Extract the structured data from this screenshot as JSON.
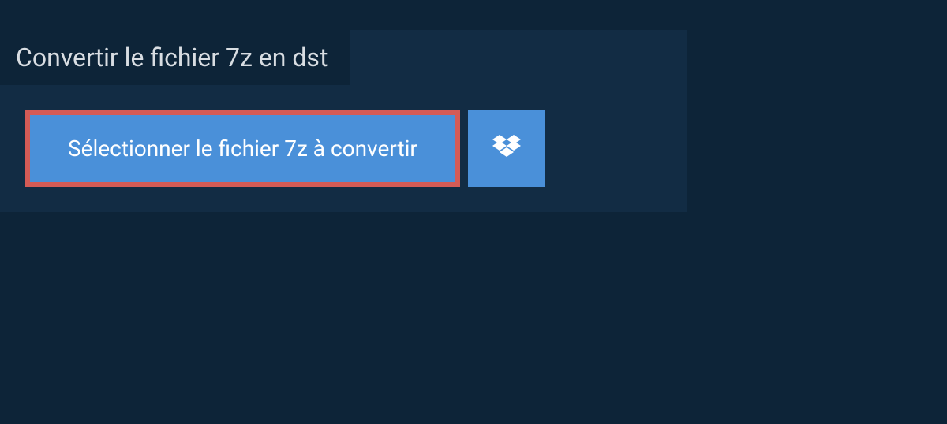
{
  "title": "Convertir le fichier 7z en dst",
  "buttons": {
    "select_file_label": "Sélectionner le fichier 7z à convertir"
  },
  "colors": {
    "page_bg": "#0d2438",
    "panel_bg": "#122c44",
    "button_bg": "#4a90d9",
    "highlight_border": "#d45b56",
    "text_light": "#d8dde2",
    "text_white": "#ffffff"
  }
}
